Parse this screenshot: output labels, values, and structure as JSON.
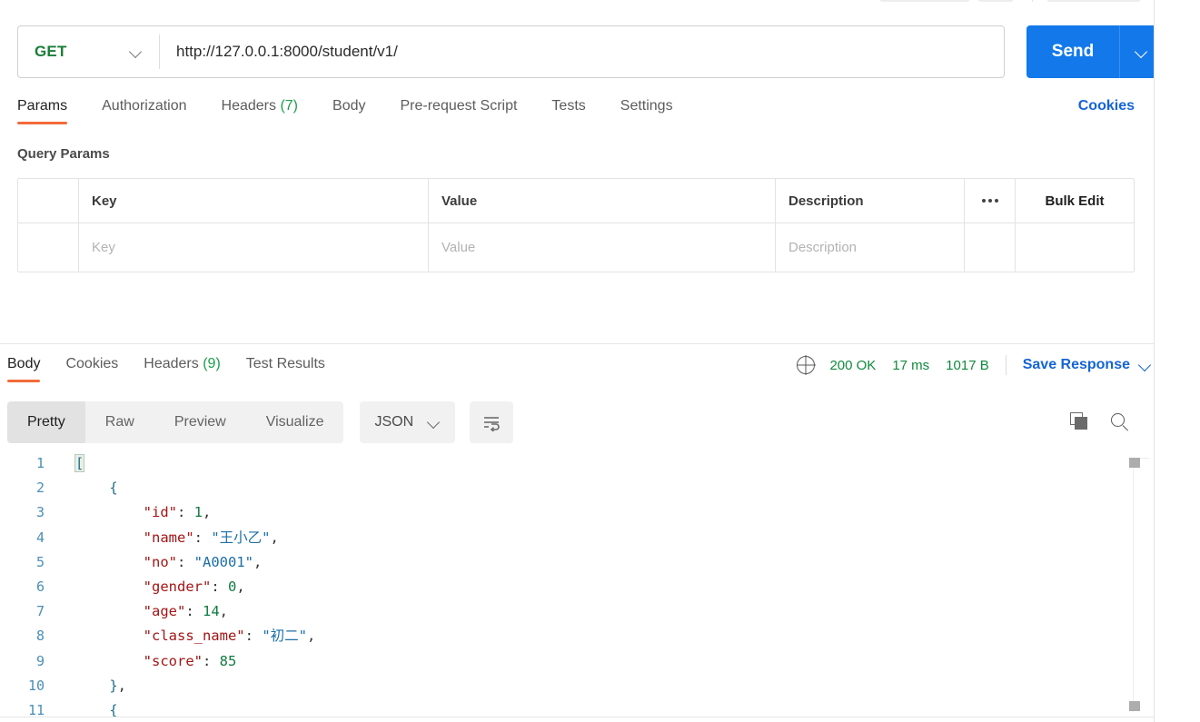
{
  "request": {
    "method": "GET",
    "url": "http://127.0.0.1:8000/student/v1/",
    "send_label": "Send",
    "tabs": [
      {
        "label": "Params",
        "count": ""
      },
      {
        "label": "Authorization",
        "count": ""
      },
      {
        "label": "Headers",
        "count": "(7)"
      },
      {
        "label": "Body",
        "count": ""
      },
      {
        "label": "Pre-request Script",
        "count": ""
      },
      {
        "label": "Tests",
        "count": ""
      },
      {
        "label": "Settings",
        "count": ""
      }
    ],
    "active_tab": "Params",
    "cookies_label": "Cookies",
    "query_params_title": "Query Params",
    "table": {
      "headers": [
        "Key",
        "Value",
        "Description"
      ],
      "dots_label": "ooo",
      "bulk_edit_label": "Bulk Edit",
      "rows": [
        {
          "key": "Key",
          "value": "Value",
          "description": "Description"
        }
      ]
    }
  },
  "response": {
    "tabs": [
      {
        "label": "Body",
        "count": ""
      },
      {
        "label": "Cookies",
        "count": ""
      },
      {
        "label": "Headers",
        "count": "(9)"
      },
      {
        "label": "Test Results",
        "count": ""
      }
    ],
    "active_tab": "Body",
    "status": "200 OK",
    "time": "17 ms",
    "size": "1017 B",
    "save_response_label": "Save Response",
    "view_modes": [
      "Pretty",
      "Raw",
      "Preview",
      "Visualize"
    ],
    "active_view": "Pretty",
    "format": "JSON",
    "colors": {
      "accent_orange": "#f26b3a",
      "link_blue": "#1464d6",
      "send_blue": "#1379ea",
      "status_green": "#0f8a3c",
      "method_green": "#1a7f37"
    },
    "body_lines": [
      {
        "n": "1",
        "tokens": [
          {
            "t": "[",
            "c": "br hl"
          }
        ]
      },
      {
        "n": "2",
        "tokens": [
          {
            "t": "    ",
            "c": "p"
          },
          {
            "t": "{",
            "c": "br"
          }
        ]
      },
      {
        "n": "3",
        "tokens": [
          {
            "t": "        ",
            "c": "p"
          },
          {
            "t": "\"id\"",
            "c": "key"
          },
          {
            "t": ": ",
            "c": "p"
          },
          {
            "t": "1",
            "c": "num"
          },
          {
            "t": ",",
            "c": "p"
          }
        ]
      },
      {
        "n": "4",
        "tokens": [
          {
            "t": "        ",
            "c": "p"
          },
          {
            "t": "\"name\"",
            "c": "key"
          },
          {
            "t": ": ",
            "c": "p"
          },
          {
            "t": "\"王小乙\"",
            "c": "str"
          },
          {
            "t": ",",
            "c": "p"
          }
        ]
      },
      {
        "n": "5",
        "tokens": [
          {
            "t": "        ",
            "c": "p"
          },
          {
            "t": "\"no\"",
            "c": "key"
          },
          {
            "t": ": ",
            "c": "p"
          },
          {
            "t": "\"A0001\"",
            "c": "str"
          },
          {
            "t": ",",
            "c": "p"
          }
        ]
      },
      {
        "n": "6",
        "tokens": [
          {
            "t": "        ",
            "c": "p"
          },
          {
            "t": "\"gender\"",
            "c": "key"
          },
          {
            "t": ": ",
            "c": "p"
          },
          {
            "t": "0",
            "c": "num"
          },
          {
            "t": ",",
            "c": "p"
          }
        ]
      },
      {
        "n": "7",
        "tokens": [
          {
            "t": "        ",
            "c": "p"
          },
          {
            "t": "\"age\"",
            "c": "key"
          },
          {
            "t": ": ",
            "c": "p"
          },
          {
            "t": "14",
            "c": "num"
          },
          {
            "t": ",",
            "c": "p"
          }
        ]
      },
      {
        "n": "8",
        "tokens": [
          {
            "t": "        ",
            "c": "p"
          },
          {
            "t": "\"class_name\"",
            "c": "key"
          },
          {
            "t": ": ",
            "c": "p"
          },
          {
            "t": "\"初二\"",
            "c": "str"
          },
          {
            "t": ",",
            "c": "p"
          }
        ]
      },
      {
        "n": "9",
        "tokens": [
          {
            "t": "        ",
            "c": "p"
          },
          {
            "t": "\"score\"",
            "c": "key"
          },
          {
            "t": ": ",
            "c": "p"
          },
          {
            "t": "85",
            "c": "num"
          }
        ]
      },
      {
        "n": "10",
        "tokens": [
          {
            "t": "    ",
            "c": "p"
          },
          {
            "t": "}",
            "c": "br"
          },
          {
            "t": ",",
            "c": "p"
          }
        ]
      },
      {
        "n": "11",
        "tokens": [
          {
            "t": "    ",
            "c": "p"
          },
          {
            "t": "{",
            "c": "br"
          }
        ]
      }
    ]
  }
}
